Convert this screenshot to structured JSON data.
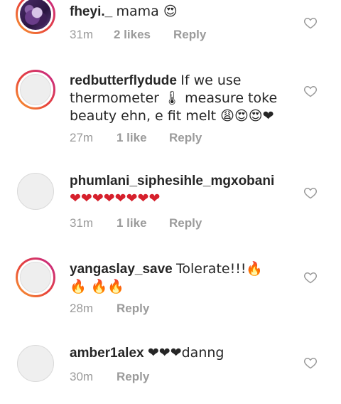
{
  "comments": [
    {
      "username": "fheyi._",
      "text": "mama 😍",
      "time": "31m",
      "likes": "2 likes",
      "reply": "Reply",
      "avatar": "photo-ring",
      "icon": "heart-outline-icon"
    },
    {
      "username": "redbutterflydude",
      "text": "If we use thermometer 🌡 measure toke beauty ehn, e fit melt 😩😍😍❤",
      "time": "27m",
      "likes": "1 like",
      "reply": "Reply",
      "avatar": "empty-ring",
      "icon": "heart-outline-icon"
    },
    {
      "username": "phumlani_siphesihle_mgxobani",
      "text": "❤❤❤❤❤❤❤❤",
      "time": "31m",
      "likes": "1 like",
      "reply": "Reply",
      "avatar": "plain",
      "icon": "heart-outline-icon"
    },
    {
      "username": "yangaslay_save",
      "text": "Tolerate!!!🔥 🔥 🔥🔥",
      "time": "28m",
      "likes": "",
      "reply": "Reply",
      "avatar": "empty-ring",
      "icon": "heart-outline-icon"
    },
    {
      "username": "amber1alex",
      "text": "❤❤❤danng",
      "time": "30m",
      "likes": "",
      "reply": "Reply",
      "avatar": "plain",
      "icon": "heart-outline-icon"
    }
  ],
  "colors": {
    "text": "#262626",
    "meta": "#9b9b9b",
    "ring_start": "#f9a030",
    "ring_end": "#c2268f"
  }
}
